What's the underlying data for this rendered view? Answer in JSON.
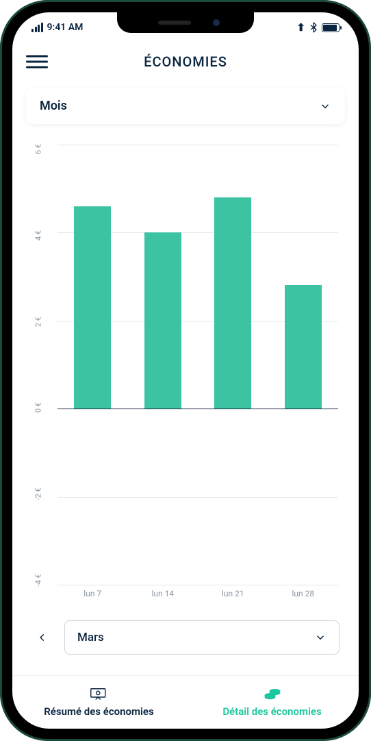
{
  "status": {
    "time": "9:41 AM"
  },
  "header": {
    "title": "ÉCONOMIES"
  },
  "period_selector": {
    "label": "Mois"
  },
  "chart_data": {
    "type": "bar",
    "categories": [
      "lun 7",
      "lun 14",
      "lun 21",
      "lun 28"
    ],
    "values": [
      4.6,
      4.0,
      4.8,
      2.8
    ],
    "ylabel": "€",
    "ylim": [
      -4,
      6
    ],
    "yticks": [
      "6 €",
      "4 €",
      "2 €",
      "0 €",
      "-2 €",
      "-4 €"
    ],
    "bar_color": "#3cc3a2"
  },
  "month_nav": {
    "month": "Mars"
  },
  "tabs": {
    "summary": {
      "label": "Résumé des économies",
      "active": false
    },
    "detail": {
      "label": "Détail des économies",
      "active": true
    }
  }
}
